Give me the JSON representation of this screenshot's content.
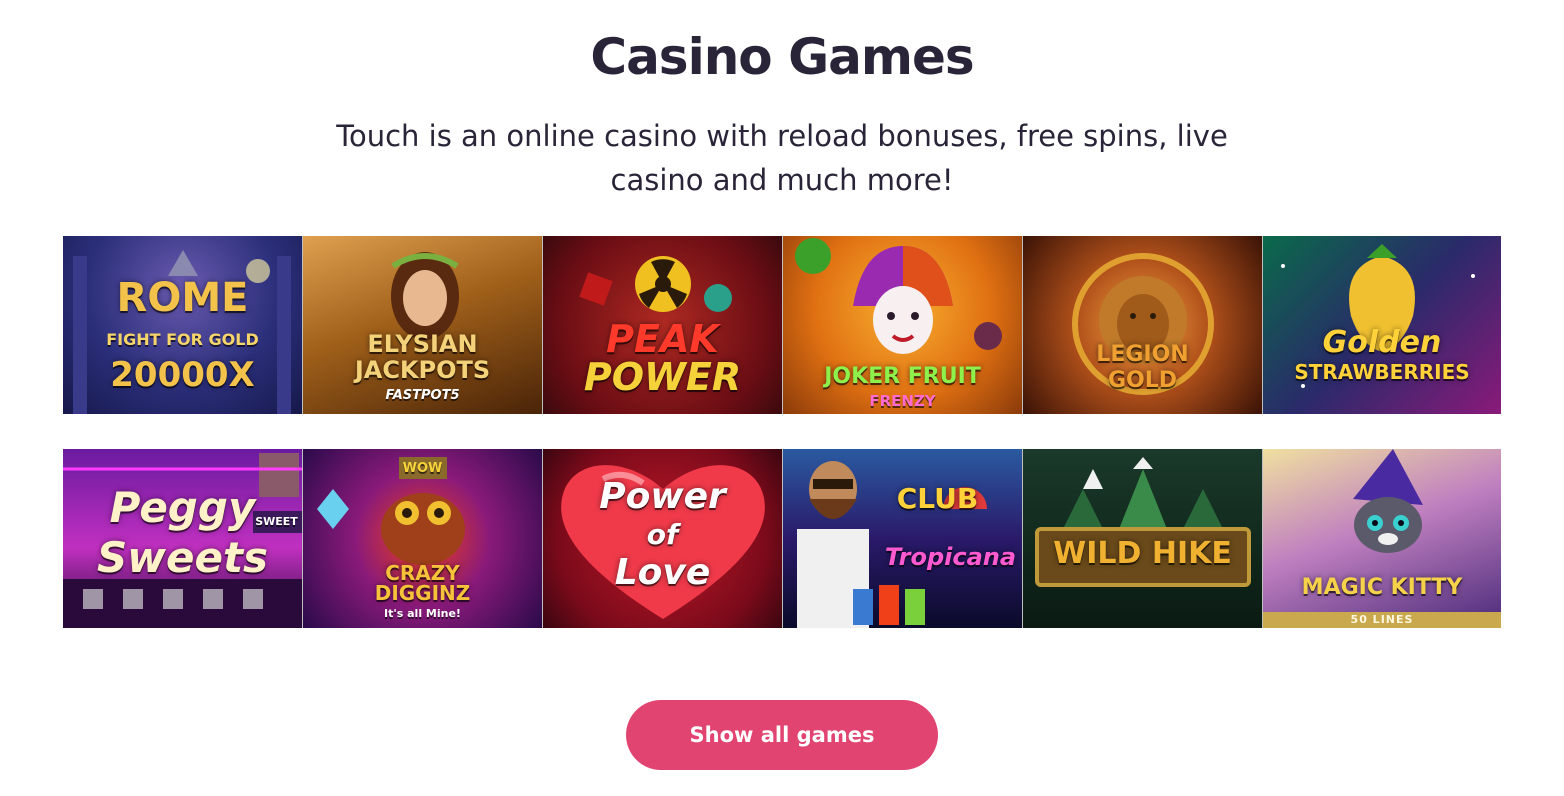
{
  "section": {
    "title": "Casino Games",
    "subtitle_line1": "Touch is an online casino with reload bonuses, free spins, live",
    "subtitle_line2": "casino and much more!"
  },
  "games_row1": [
    {
      "id": "rome",
      "name_line1": "ROME",
      "name_line2": "FIGHT FOR GOLD",
      "name_line3": "20000X",
      "bg_from": "#2b2f7a",
      "bg_to": "#5a3a8a",
      "text_color": "#f2c24a"
    },
    {
      "id": "elysian",
      "name_line1": "ELYSIAN",
      "name_line2": "JACKPOTS",
      "name_line3": "FASTPOT5",
      "bg_from": "#6b3a12",
      "bg_to": "#c58a3a",
      "text_color": "#f4d27a"
    },
    {
      "id": "peak-power",
      "name_line1": "PEAK",
      "name_line2": "POWER",
      "bg_from": "#5a0d14",
      "bg_to": "#a31c22",
      "text_color": "#ff3a2a"
    },
    {
      "id": "joker-fruit",
      "name_line1": "JOKER FRUIT",
      "name_line2": "FRENZY",
      "bg_from": "#b84a10",
      "bg_to": "#f09a20",
      "text_color": "#8ef04a"
    },
    {
      "id": "legion-gold",
      "name_line1": "LEGION",
      "name_line2": "GOLD",
      "bg_from": "#4a1a08",
      "bg_to": "#b0501a",
      "text_color": "#f0a030"
    },
    {
      "id": "golden-strawberries",
      "name_line1": "Golden",
      "name_line2": "STRAWBERRIES",
      "bg_from": "#0a5a3a",
      "bg_to": "#7a1a6a",
      "text_color": "#ffd23a"
    }
  ],
  "games_row2": [
    {
      "id": "peggy-sweets",
      "name_line1": "Peggy",
      "name_line2": "Sweets",
      "extra": "SWEET",
      "bg_from": "#4a0d6a",
      "bg_to": "#b02ab0",
      "text_color": "#fff1c8"
    },
    {
      "id": "crazy-digginz",
      "name_line1": "CRAZY",
      "name_line2": "DIGGINZ",
      "name_line3": "It's all Mine!",
      "extra": "WOW",
      "bg_from": "#3a0a5a",
      "bg_to": "#8a1a7a",
      "text_color": "#f6c23a"
    },
    {
      "id": "power-of-love",
      "name_line1": "Power",
      "name_line2": "of",
      "name_line3": "Love",
      "bg_from": "#8a0a1a",
      "bg_to": "#e02a3a",
      "text_color": "#ffffff"
    },
    {
      "id": "club-tropicana",
      "name_line1": "CLUB",
      "name_line2": "Tropicana",
      "bg_from": "#0a1a4a",
      "bg_to": "#3a2a7a",
      "text_color": "#ffd23a"
    },
    {
      "id": "wild-hike",
      "name_line1": "WILD HIKE",
      "bg_from": "#0a1a14",
      "bg_to": "#1f4a2a",
      "text_color": "#f0b030"
    },
    {
      "id": "magic-kitty",
      "name_line1": "MAGIC KITTY",
      "strip": "50 LINES",
      "bg_from": "#4a2a7a",
      "bg_to": "#d08ad0",
      "text_color": "#f6d24a"
    }
  ],
  "button": {
    "label": "Show all games"
  },
  "colors": {
    "accent": "#e14471",
    "heading": "#2a2438"
  }
}
